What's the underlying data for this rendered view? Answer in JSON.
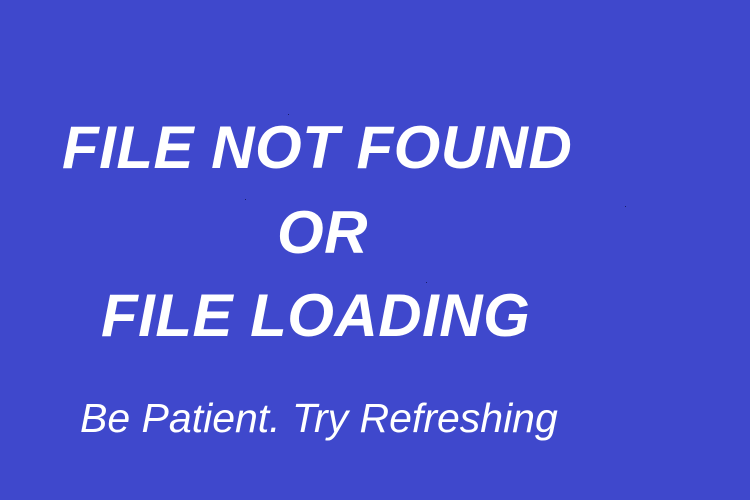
{
  "message": {
    "line_1": "FILE NOT FOUND",
    "line_2": "OR",
    "line_3": "FILE LOADING",
    "subtext": "Be Patient. Try Refreshing"
  },
  "colors": {
    "background": "#3f48cc",
    "text": "#ffffff"
  }
}
